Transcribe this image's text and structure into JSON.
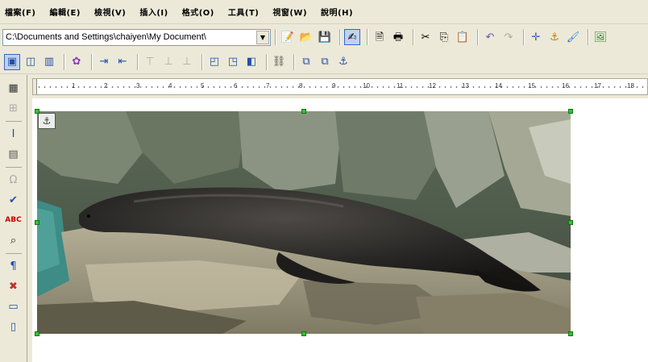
{
  "menu": [
    "檔案(F)",
    "編輯(E)",
    "檢視(V)",
    "插入(I)",
    "格式(O)",
    "工具(T)",
    "視窗(W)",
    "說明(H)"
  ],
  "path": {
    "value": "C:\\Documents and Settings\\chaiyen\\My Document\\"
  },
  "ruler": {
    "labels": [
      "1",
      "2",
      "3",
      "4",
      "5",
      "6",
      "7",
      "8",
      "9",
      "10",
      "11",
      "12",
      "13",
      "14",
      "15",
      "16",
      "17",
      "18"
    ]
  },
  "colors": {
    "chrome": "#ece9d8",
    "handle": "#2fc52f",
    "border": "#7f9db9"
  }
}
